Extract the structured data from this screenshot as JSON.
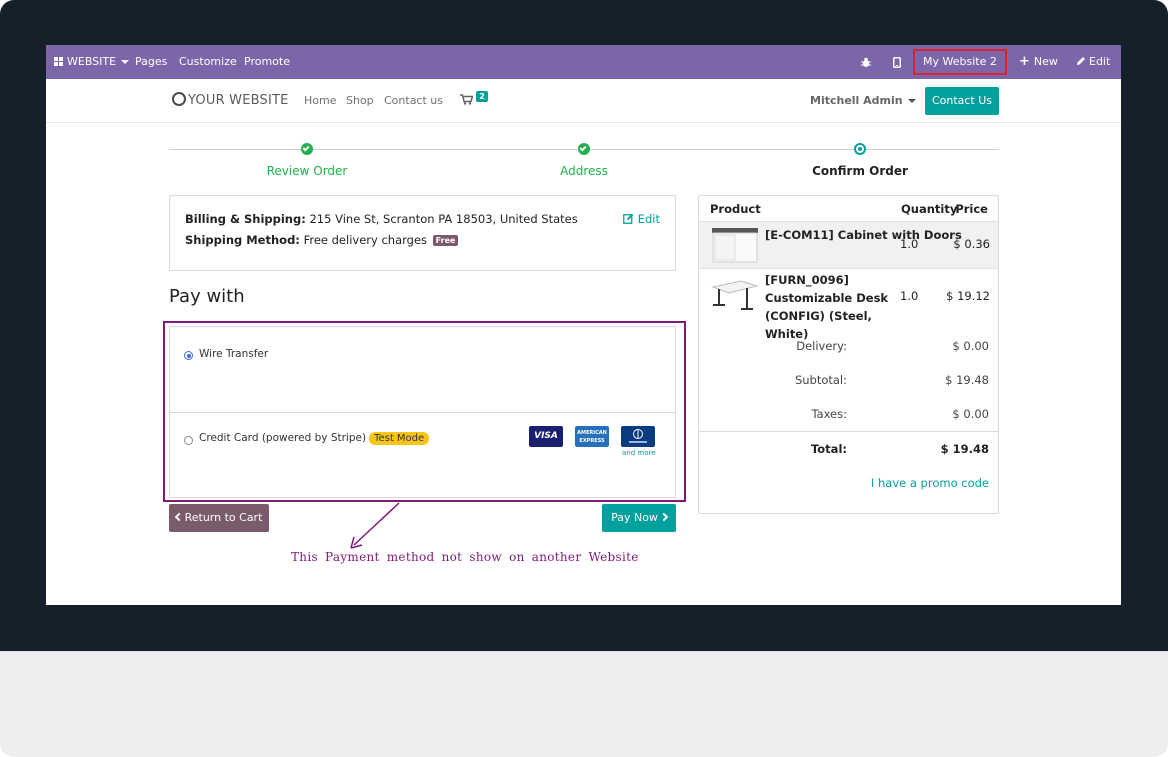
{
  "admin_bar": {
    "website_menu": "WEBSITE",
    "pages": "Pages",
    "customize": "Customize",
    "promote": "Promote",
    "site_switcher": "My Website 2",
    "new": "New",
    "edit": "Edit"
  },
  "navbar": {
    "logo": "YOUR WEBSITE",
    "links": [
      "Home",
      "Shop",
      "Contact us"
    ],
    "cart_count": "2",
    "user": "Mitchell Admin",
    "contact_button": "Contact Us"
  },
  "progress": {
    "steps": [
      {
        "label": "Review Order",
        "state": "done"
      },
      {
        "label": "Address",
        "state": "done"
      },
      {
        "label": "Confirm Order",
        "state": "current"
      }
    ]
  },
  "billing": {
    "billing_label": "Billing & Shipping:",
    "billing_value": "215 Vine St, Scranton PA 18503, United States",
    "shipping_label": "Shipping Method:",
    "shipping_value": "Free delivery charges",
    "shipping_badge": "Free",
    "edit_label": "Edit"
  },
  "pay_with": {
    "heading": "Pay with",
    "methods": [
      {
        "label": "Wire Transfer",
        "selected": true
      },
      {
        "label": "Credit Card (powered by Stripe)",
        "badge": "Test Mode",
        "selected": false
      }
    ],
    "card_icons": [
      "VISA",
      "American Express",
      "Diners Club"
    ],
    "and_more": "and more"
  },
  "buttons": {
    "return_to_cart": "Return to Cart",
    "pay_now": "Pay Now"
  },
  "annotation": "This Payment method not show on another Website",
  "order_summary": {
    "headers": {
      "product": "Product",
      "quantity": "Quantity",
      "price": "Price"
    },
    "items": [
      {
        "name": "[E-COM11] Cabinet with Doors",
        "quantity": "1.0",
        "price": "$ 0.36"
      },
      {
        "name": "[FURN_0096] Customizable Desk (CONFIG) (Steel, White)",
        "quantity": "1.0",
        "price": "$ 19.12"
      }
    ],
    "delivery_label": "Delivery:",
    "delivery_value": "$ 0.00",
    "subtotal_label": "Subtotal:",
    "subtotal_value": "$ 19.48",
    "taxes_label": "Taxes:",
    "taxes_value": "$ 0.00",
    "total_label": "Total:",
    "total_value": "$ 19.48",
    "promo_link": "I have a promo code"
  },
  "colors": {
    "admin_bar": "#7c65a9",
    "accent": "#00a09d",
    "success": "#21b04b",
    "highlight_border": "#7e1a7a",
    "switcher_border": "#d9252d"
  }
}
